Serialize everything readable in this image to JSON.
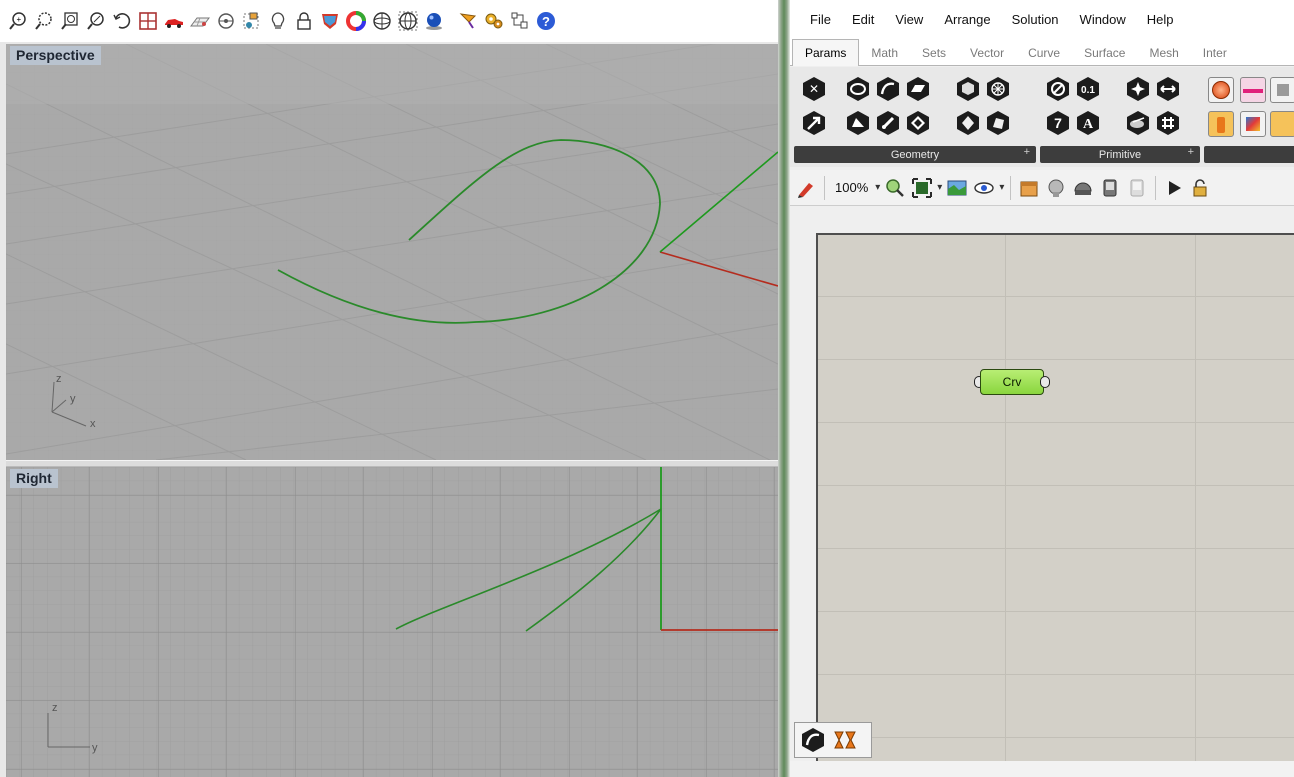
{
  "rhino": {
    "toolbar_icons": [
      "zoom-extents-icon",
      "zoom-window-icon",
      "zoom-selected-icon",
      "zoom-dynamic-icon",
      "rotate-view-icon",
      "four-viewports-icon",
      "car-icon",
      "grid-plane-icon",
      "point-on-icon",
      "shaded-point-icon",
      "light-bulb-icon",
      "lock-icon",
      "render-shield-icon",
      "color-wheel-icon",
      "sphere-wire-icon",
      "sphere-mesh-icon",
      "blue-sphere-icon",
      "pen-select-icon",
      "gear-options-icon",
      "layout-grid-icon",
      "help-icon"
    ],
    "viewports": {
      "perspective": {
        "label": "Perspective",
        "axis_z": "z",
        "axis_y": "y",
        "axis_x": "x"
      },
      "right": {
        "label": "Right",
        "axis_z": "z",
        "axis_y": "y"
      }
    }
  },
  "grasshopper": {
    "menu": [
      "File",
      "Edit",
      "View",
      "Arrange",
      "Solution",
      "Window",
      "Help"
    ],
    "tabs": [
      "Params",
      "Math",
      "Sets",
      "Vector",
      "Curve",
      "Surface",
      "Mesh",
      "Inter"
    ],
    "active_tab": "Params",
    "panels": [
      {
        "title": "Geometry",
        "plus": "+"
      },
      {
        "title": "Primitive",
        "plus": "+"
      }
    ],
    "primitive_icon_labels": {
      "integer": "0.1",
      "number": "7",
      "text": "A"
    },
    "canvas_toolbar": {
      "zoom": "100%"
    },
    "component": {
      "label": "Crv"
    }
  },
  "colors": {
    "curve_green": "#2a8a2a",
    "axis_red": "#b52c1e",
    "axis_green": "#1e9a1e",
    "component_green": "#9ee052",
    "viewport_bg": "#a8a8a8",
    "canvas_bg": "#d3d0c8"
  }
}
